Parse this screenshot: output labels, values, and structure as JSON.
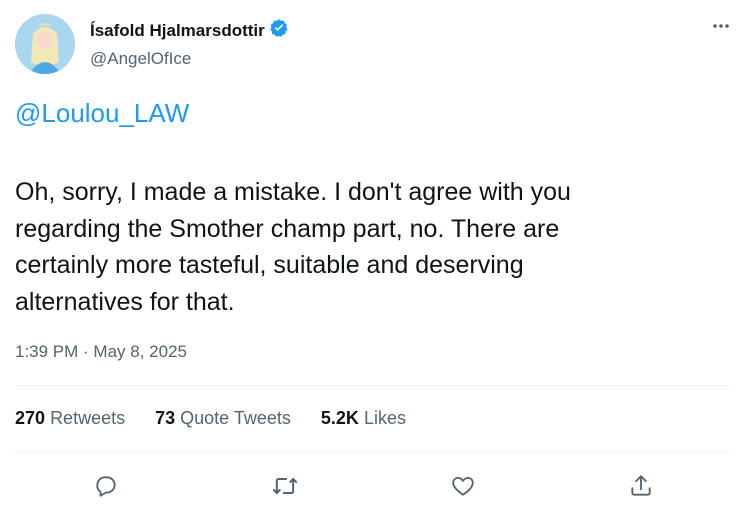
{
  "author": {
    "display_name": "Ísafold Hjalmarsdottir",
    "handle": "@AngelOfIce",
    "verified": true
  },
  "tweet": {
    "mention": "@Loulou_LAW",
    "text": "Oh, sorry, I made a mistake. I don't agree with you\nregarding the Smother champ part, no. There are\ncertainly more tasteful, suitable and deserving\nalternatives for that.",
    "timestamp": "1:39 PM · May 8, 2025"
  },
  "stats": {
    "retweets_count": "270",
    "retweets_label": "Retweets",
    "quotes_count": "73",
    "quotes_label": "Quote Tweets",
    "likes_count": "5.2K",
    "likes_label": "Likes"
  },
  "colors": {
    "accent": "#1d9bf0",
    "secondary_text": "#536471",
    "divider": "#eff3f4"
  },
  "icons": {
    "more": "more-dots-icon",
    "verified": "verified-badge-icon",
    "reply": "reply-icon",
    "retweet": "retweet-icon",
    "like": "heart-icon",
    "share": "share-icon"
  }
}
